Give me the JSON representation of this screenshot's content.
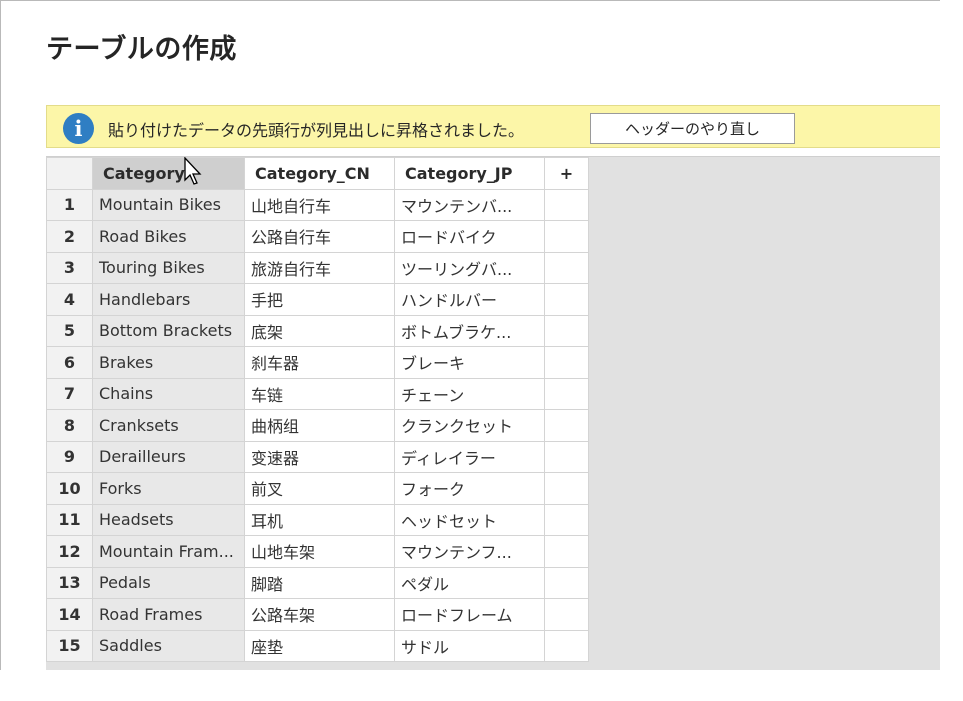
{
  "dialog": {
    "title": "テーブルの作成"
  },
  "infobar": {
    "icon": "info-icon",
    "message": "貼り付けたデータの先頭行が列見出しに昇格されました。",
    "redo_label": "ヘッダーのやり直し",
    "bg_color": "#fcf6a8",
    "icon_color": "#2f7ec3"
  },
  "grid": {
    "add_column_label": "+",
    "columns": [
      "Category",
      "Category_CN",
      "Category_JP"
    ],
    "rows": [
      {
        "n": "1",
        "cat": "Mountain Bikes",
        "cn": "山地自行车",
        "jp": "マウンテンバ..."
      },
      {
        "n": "2",
        "cat": "Road Bikes",
        "cn": "公路自行车",
        "jp": "ロードバイク"
      },
      {
        "n": "3",
        "cat": "Touring Bikes",
        "cn": "旅游自行车",
        "jp": "ツーリングバ..."
      },
      {
        "n": "4",
        "cat": "Handlebars",
        "cn": "手把",
        "jp": "ハンドルバー"
      },
      {
        "n": "5",
        "cat": "Bottom Brackets",
        "cn": "底架",
        "jp": "ボトムブラケ..."
      },
      {
        "n": "6",
        "cat": "Brakes",
        "cn": "刹车器",
        "jp": "ブレーキ"
      },
      {
        "n": "7",
        "cat": "Chains",
        "cn": "车链",
        "jp": "チェーン"
      },
      {
        "n": "8",
        "cat": "Cranksets",
        "cn": "曲柄组",
        "jp": "クランクセット"
      },
      {
        "n": "9",
        "cat": "Derailleurs",
        "cn": "变速器",
        "jp": "ディレイラー"
      },
      {
        "n": "10",
        "cat": "Forks",
        "cn": "前叉",
        "jp": "フォーク"
      },
      {
        "n": "11",
        "cat": "Headsets",
        "cn": "耳机",
        "jp": "ヘッドセット"
      },
      {
        "n": "12",
        "cat": "Mountain Fram...",
        "cn": "山地车架",
        "jp": "マウンテンフ..."
      },
      {
        "n": "13",
        "cat": "Pedals",
        "cn": "脚踏",
        "jp": "ペダル"
      },
      {
        "n": "14",
        "cat": "Road Frames",
        "cn": "公路车架",
        "jp": "ロードフレーム"
      },
      {
        "n": "15",
        "cat": "Saddles",
        "cn": "座垫",
        "jp": "サドル"
      }
    ]
  }
}
